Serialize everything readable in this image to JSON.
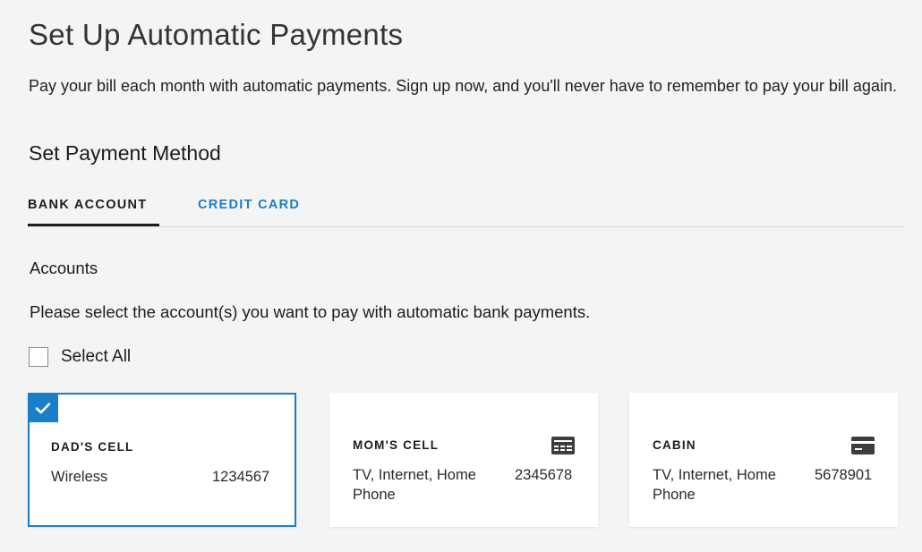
{
  "page": {
    "title": "Set Up Automatic Payments",
    "intro": "Pay your bill each month with automatic payments. Sign up now, and you'll never have to remember to pay your bill again."
  },
  "payment_method": {
    "title": "Set Payment Method",
    "tabs": [
      {
        "label": "BANK ACCOUNT",
        "active": true
      },
      {
        "label": "CREDIT CARD",
        "active": false
      }
    ]
  },
  "accounts": {
    "heading": "Accounts",
    "description": "Please select the account(s) you want to pay with automatic bank payments.",
    "select_all_label": "Select All",
    "select_all_checked": false,
    "items": [
      {
        "name": "DAD'S CELL",
        "service": "Wireless",
        "number": "1234567",
        "selected": true,
        "icon": "checkmark-icon"
      },
      {
        "name": "MOM'S CELL",
        "service": "TV, Internet, Home Phone",
        "number": "2345678",
        "selected": false,
        "icon": "cable-box-icon"
      },
      {
        "name": "CABIN",
        "service": "TV, Internet, Home Phone",
        "number": "5678901",
        "selected": false,
        "icon": "credit-card-icon"
      }
    ]
  },
  "colors": {
    "accent": "#1a7ec8",
    "background": "#f4f4f4",
    "text": "#1c1c1c"
  }
}
